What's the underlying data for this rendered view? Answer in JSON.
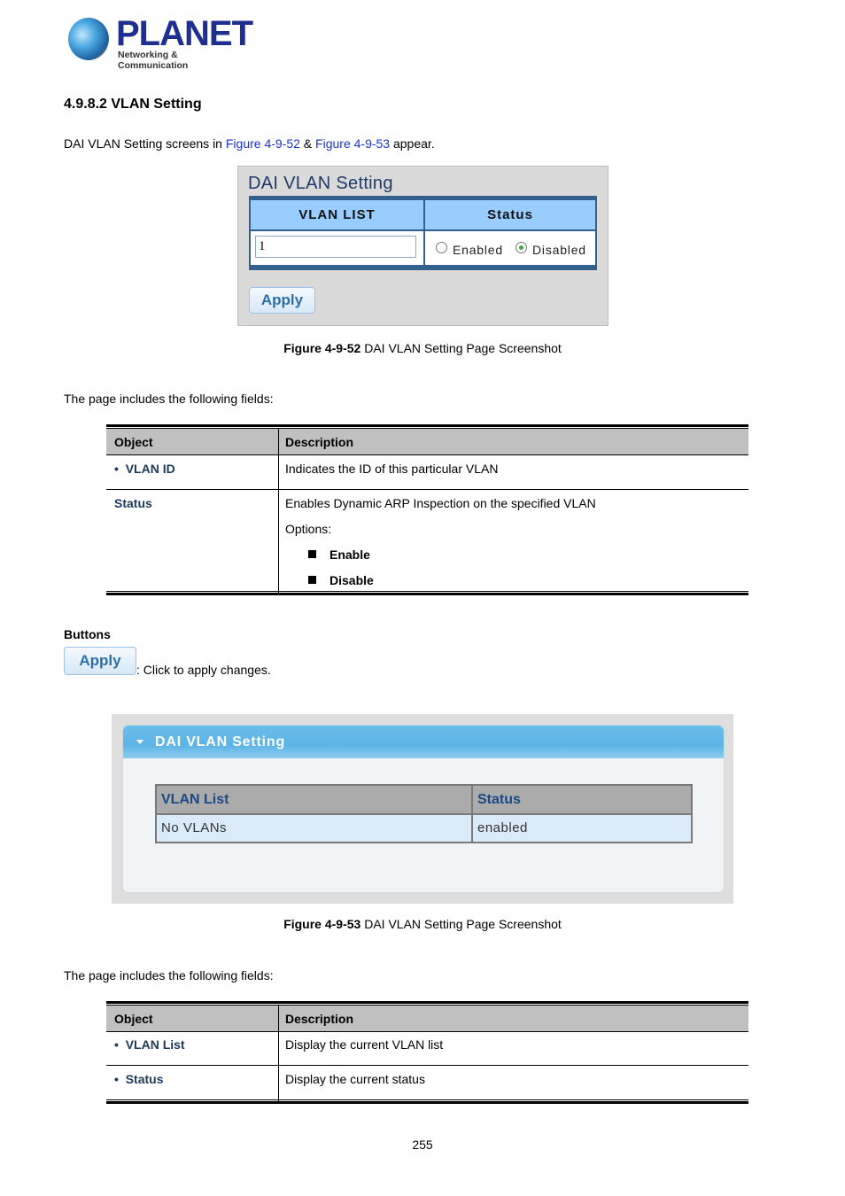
{
  "logo": {
    "brand": "PLANET",
    "tagline": "Networking & Communication"
  },
  "section": {
    "heading": "4.9.8.2 VLAN Setting",
    "intro_prefix": "DAI VLAN Setting screens in ",
    "intro_link1": "Figure 4-9-52",
    "intro_mid": " & ",
    "intro_link2": "Figure 4-9-53",
    "intro_suffix": " appear."
  },
  "figure1": {
    "title": "DAI VLAN Setting",
    "col_vlan_list": "VLAN LIST",
    "col_status": "Status",
    "vlan_input_value": "1",
    "radio_enabled_label": "Enabled",
    "radio_disabled_label": "Disabled",
    "selected_status": "Disabled",
    "apply_label": "Apply",
    "caption_bold": "Figure 4-9-52",
    "caption_text": " DAI VLAN Setting Page Screenshot"
  },
  "fields_intro_1": "The page includes the following fields:",
  "table1": {
    "headers": [
      "Object",
      "Description"
    ],
    "rows": [
      {
        "object": "VLAN ID",
        "bullet": true,
        "description": "Indicates the ID of this particular VLAN"
      },
      {
        "object": "Status",
        "bullet": false,
        "description": "Enables Dynamic ARP Inspection on the specified VLAN",
        "options_label": "Options:",
        "options": [
          "Enable",
          "Disable"
        ]
      }
    ]
  },
  "buttons": {
    "heading": "Buttons",
    "apply_label": "Apply",
    "apply_desc": ": Click to apply changes."
  },
  "figure2": {
    "title": "DAI VLAN Setting",
    "col_vlan_list": "VLAN List",
    "col_status": "Status",
    "vlan_list_value": "No VLANs",
    "status_value": "enabled",
    "caption_bold": "Figure 4-9-53",
    "caption_text": " DAI VLAN Setting Page Screenshot"
  },
  "fields_intro_2": "The page includes the following fields:",
  "table2": {
    "headers": [
      "Object",
      "Description"
    ],
    "rows": [
      {
        "object": "VLAN List",
        "bullet": true,
        "description": "Display the current VLAN list"
      },
      {
        "object": "Status",
        "bullet": true,
        "description": "Display the current status"
      }
    ]
  },
  "page_number": "255"
}
